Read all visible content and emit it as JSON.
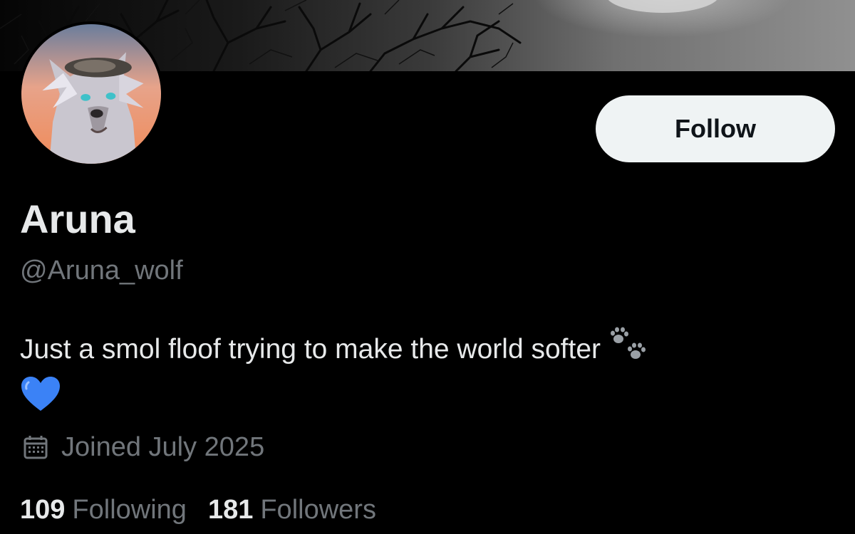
{
  "banner": {
    "icon": "moonlit-trees-banner"
  },
  "profile": {
    "avatar_icon": "wolf-avatar",
    "display_name": "Aruna",
    "handle": "@Aruna_wolf",
    "bio_text": "Just a smol floof trying to make the world softer",
    "bio_emojis": [
      "paw-prints-icon",
      "blue-heart-icon"
    ],
    "joined_text": "Joined July 2025",
    "joined_icon": "calendar-icon"
  },
  "actions": {
    "follow_label": "Follow"
  },
  "stats": {
    "following_count": "109",
    "following_label": "Following",
    "followers_count": "181",
    "followers_label": "Followers"
  },
  "colors": {
    "background": "#000000",
    "primary_text": "#e7e9ea",
    "secondary_text": "#71767b",
    "follow_button_bg": "#eff3f4",
    "heart": "#3b82f6"
  }
}
